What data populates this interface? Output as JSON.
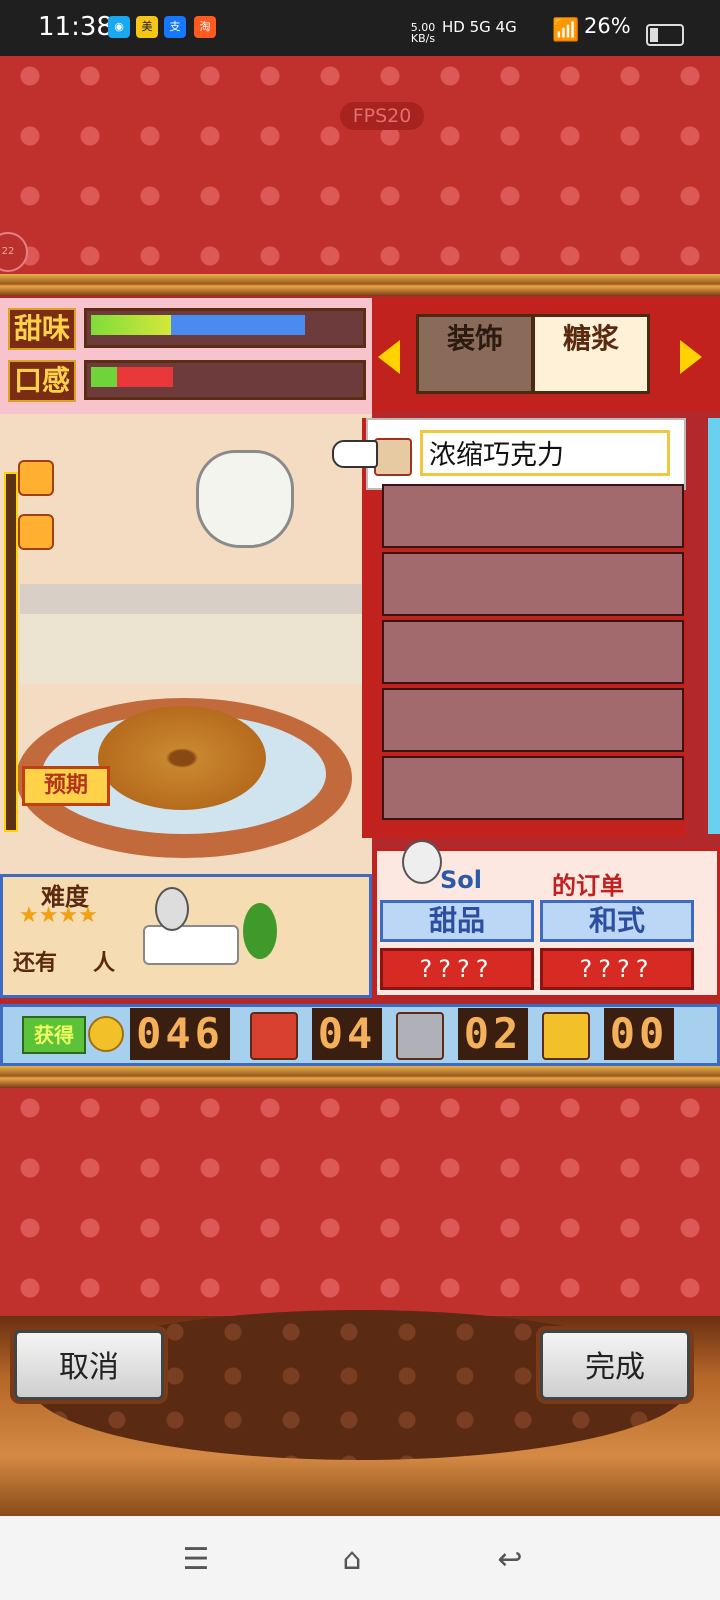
{
  "status_bar": {
    "time": "11:38",
    "notif_icons": [
      "qq-icon",
      "meituan-icon",
      "alipay-icon",
      "taobao-icon"
    ],
    "net_speed": "5.00 KB/s",
    "signal_labels": "HD 5G 4G",
    "battery": "26%",
    "battery_level": 0.26
  },
  "game": {
    "fps": "FPS20",
    "stats": {
      "sweetness_label": "甜味",
      "texture_label": "口感",
      "sweetness_level": 0.78,
      "texture_level": 0.31
    },
    "tabs": {
      "decoration": "装饰",
      "sauce": "糖浆"
    },
    "ingredient_selected": "浓缩巧克力",
    "expected_label": "预期",
    "difficulty": {
      "label": "难度",
      "stars": "★★★★",
      "people_prefix": "还有",
      "people_suffix": "人"
    },
    "order": {
      "title": "的订单",
      "customer": "Sol",
      "category1": "甜品",
      "category2": "和式",
      "unknown1": "????",
      "unknown2": "????"
    },
    "counters": {
      "coin_label": "获得",
      "coins": "046",
      "red_chest": "04",
      "silver_chest": "02",
      "gold_chest": "00"
    },
    "buttons": {
      "cancel": "取消",
      "done": "完成"
    }
  },
  "colors": {
    "background_red": "#c0302c",
    "accent_gold": "#ffd200",
    "panel_blue": "#3e6bc2"
  }
}
